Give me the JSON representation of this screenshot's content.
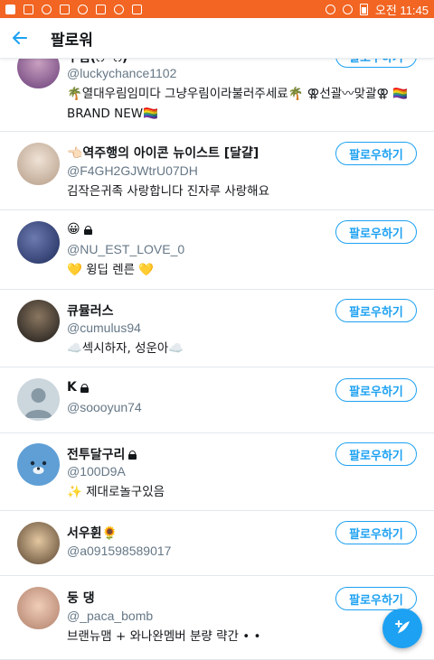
{
  "statusbar": {
    "time": "오전 11:45"
  },
  "header": {
    "title": "팔로워"
  },
  "follow_label": "팔로우하기",
  "users": [
    {
      "name": "우림(ෆ ̈ ෆ)",
      "handle": "@luckychance1102",
      "bio": "🌴열대우림임미다 그냥우림이라불러주세료🌴 ⚢선괄〰맞괄⚢ 🏳️‍🌈BRAND NEW🏳️‍🌈"
    },
    {
      "name": "👈🏻역주행의 아이콘 뉴이스트 [달걀]",
      "handle": "@F4GH2GJWtrU07DH",
      "bio": "김작은귀족 사랑합니다 진자루 사랑해요"
    },
    {
      "name": "😀",
      "handle": "@NU_EST_LOVE_0",
      "bio": "💛 윙딥 렌른 💛"
    },
    {
      "name": "큐뮬러스",
      "handle": "@cumulus94",
      "bio": "☁️섹시하자, 성운아☁️"
    },
    {
      "name": "K",
      "handle": "@soooyun74",
      "bio": ""
    },
    {
      "name": "전투달구리",
      "handle": "@100D9A",
      "bio": "✨ 제대로놀구있음"
    },
    {
      "name": "서우휜🌻",
      "handle": "@a091598589017",
      "bio": ""
    },
    {
      "name": "둥 댕",
      "handle": "@_paca_bomb",
      "bio": "브랜뉴맴 + 와나완멤버 분량 략간 • •"
    }
  ]
}
